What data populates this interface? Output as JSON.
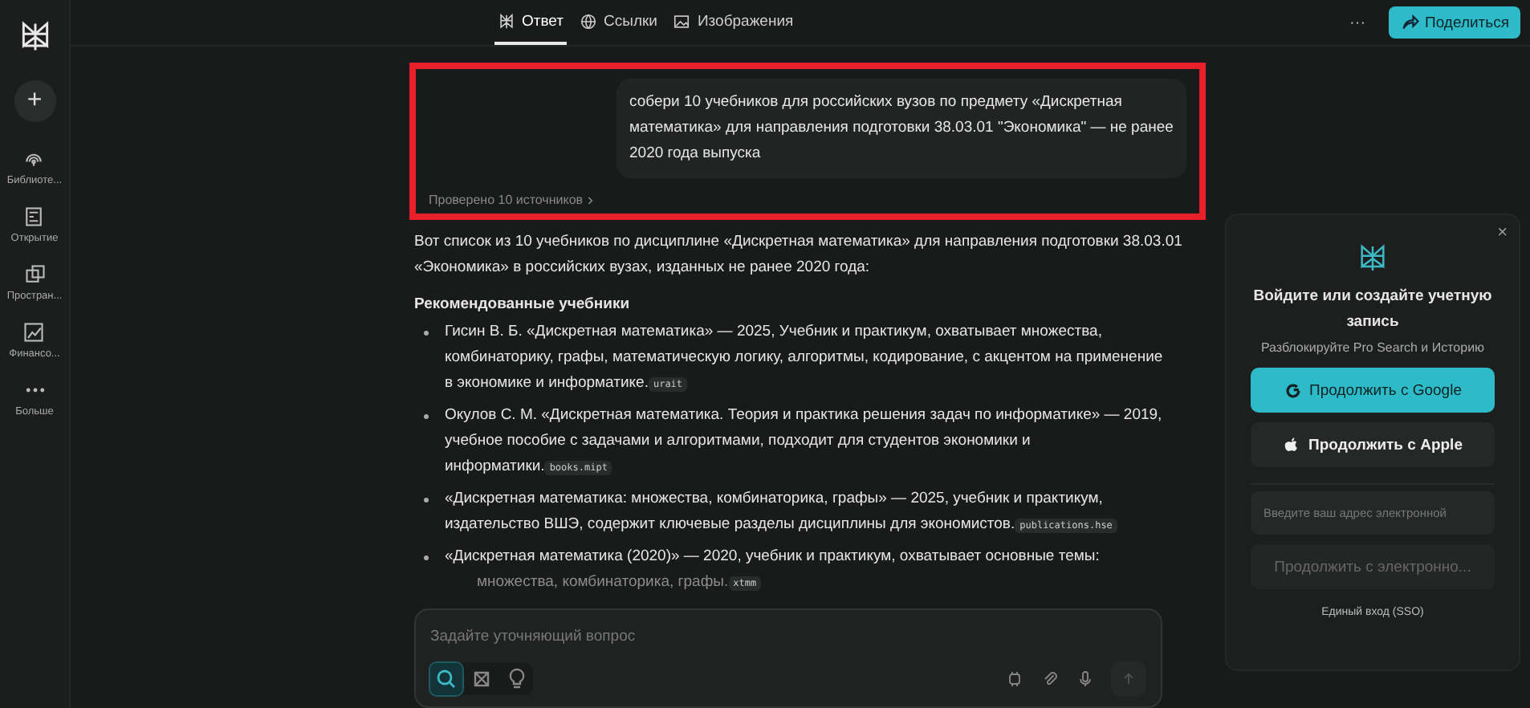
{
  "sidebar": {
    "new_button": "+",
    "items": [
      {
        "kind": "library",
        "label": "Библиоте..."
      },
      {
        "kind": "discover",
        "label": "Открытие"
      },
      {
        "kind": "spaces",
        "label": "Простран..."
      },
      {
        "kind": "finance",
        "label": "Финансо..."
      },
      {
        "kind": "more",
        "label": "Больше"
      }
    ]
  },
  "tabs": [
    {
      "kind": "answer",
      "label": "Ответ",
      "selected": true
    },
    {
      "kind": "links",
      "label": "Ссылки",
      "selected": false
    },
    {
      "kind": "images",
      "label": "Изображения",
      "selected": false
    }
  ],
  "top_actions": {
    "more": "···",
    "share": "Поделиться"
  },
  "query": "собери 10 учебников для российских вузов по предмету «Дискретная математика» для направления подготовки 38.03.01 \"Экономика\" — не ранее 2020 года выпуска",
  "sources": "Проверено 10 источников",
  "intro": "Вот список из 10 учебников по дисциплине «Дискретная математика» для направления подготовки 38.03.01 «Экономика» в российских вузах, изданных не ранее 2020 года:",
  "heading": "Рекомендованные учебники",
  "books": [
    {
      "text": "Гисин В. Б. «Дискретная математика» — 2025, Учебник и практикум, охватывает множества, комбинаторику, графы, математическую логику, алгоритмы, кодирование, с акцентом на применение в экономике и информатике.",
      "source": "urait",
      "faded": false
    },
    {
      "text": "Окулов С. М. «Дискретная математика. Теория и практика решения задач по информатике» — 2019, учебное пособие с задачами и алгоритмами, подходит для студентов экономики и информатики.",
      "source": "books.mipt",
      "faded": false
    },
    {
      "text": "«Дискретная математика: множества, комбинаторика, графы» — 2025, учебник и практикум, издательство ВШЭ, содержит ключевые разделы дисциплины для экономистов.",
      "source": "publications.hse",
      "faded": false
    },
    {
      "text": "«Дискретная математика (2020)» — 2020, учебник и практикум, охватывает основные темы:",
      "faded": false
    },
    {
      "text": "множества, комбинаторика, графы.",
      "source": "xtmm",
      "faded": true
    }
  ],
  "ask": {
    "placeholder": "Задайте уточняющий вопрос"
  },
  "login": {
    "title": "Войдите или создайте учетную запись",
    "subtitle": "Разблокируйте Pro Search и Историю",
    "google": "Продолжить с Google",
    "apple": "Продолжить с Apple",
    "email": {
      "placeholder": "Введите ваш адрес электронной"
    },
    "email_button": "Продолжить с электронно...",
    "sso": "Единый вход (SSO)",
    "close": "×"
  }
}
